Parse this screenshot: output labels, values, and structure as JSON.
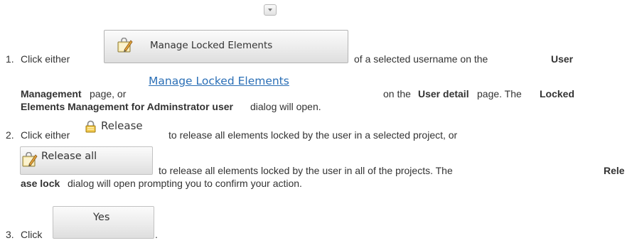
{
  "collapse_icon": "chevron-down-icon",
  "steps": [
    {
      "number": "1.",
      "t1": "Click either",
      "button_label": "Manage Locked Elements",
      "t2": "of a selected username on the",
      "b1": "User",
      "b2": "Management",
      "t3": "page, or",
      "link_label": "Manage Locked Elements",
      "t4": "on the",
      "b3": "User detail",
      "t5": "page. The",
      "b4": "Locked",
      "b5": "Elements Management for Adminstrator user",
      "t6": "dialog will open."
    },
    {
      "number": "2.",
      "t1": "Click either",
      "release_label": "Release",
      "t2": "to release all elements locked by the user in a selected project, or",
      "release_all_label": "Release all",
      "t3": "to release all elements locked by the user in all of the projects. The",
      "b1": "Rele",
      "b2": "ase lock",
      "t4": "dialog will open prompting you to confirm your action."
    },
    {
      "number": "3.",
      "t1": "Click",
      "yes_label": "Yes",
      "t2": "."
    }
  ],
  "colors": {
    "link": "#2b6fb6",
    "text": "#333333"
  }
}
